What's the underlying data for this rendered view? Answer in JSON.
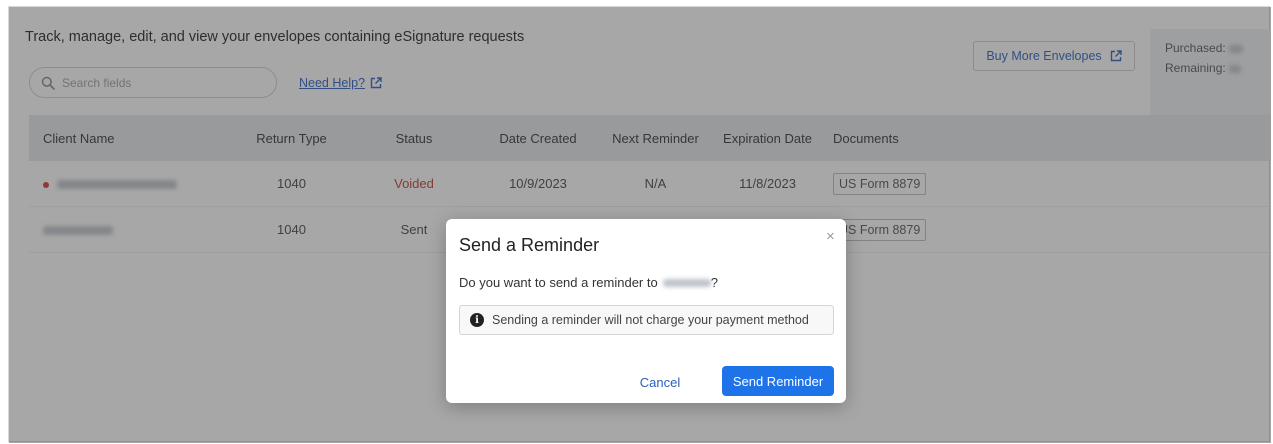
{
  "header": {
    "title": "Track, manage, edit, and view your envelopes containing eSignature requests",
    "search_placeholder": "Search fields",
    "help_link": "Need Help?",
    "buy_button": "Buy More Envelopes"
  },
  "counts": {
    "purchased_label": "Purchased:",
    "remaining_label": "Remaining:"
  },
  "table": {
    "columns": [
      "Client Name",
      "Return Type",
      "Status",
      "Date Created",
      "Next Reminder",
      "Expiration Date",
      "Documents"
    ],
    "rows": [
      {
        "return_type": "1040",
        "status": "Voided",
        "date_created": "10/9/2023",
        "next_reminder": "N/A",
        "expiration_date": "11/8/2023",
        "document": "US Form 8879"
      },
      {
        "return_type": "1040",
        "status": "Sent",
        "date_created": "",
        "next_reminder": "",
        "expiration_date": "",
        "document": "US Form 8879"
      }
    ]
  },
  "modal": {
    "title": "Send a Reminder",
    "question_prefix": "Do you want to send a reminder to",
    "question_suffix": "?",
    "info": "Sending a reminder will not charge your payment method",
    "cancel": "Cancel",
    "send": "Send Reminder",
    "close_glyph": "×"
  },
  "colors": {
    "accent": "#1e73e8",
    "link": "#2b5fbf",
    "voided": "#c0392b",
    "header_bg": "#e5e7ec"
  }
}
